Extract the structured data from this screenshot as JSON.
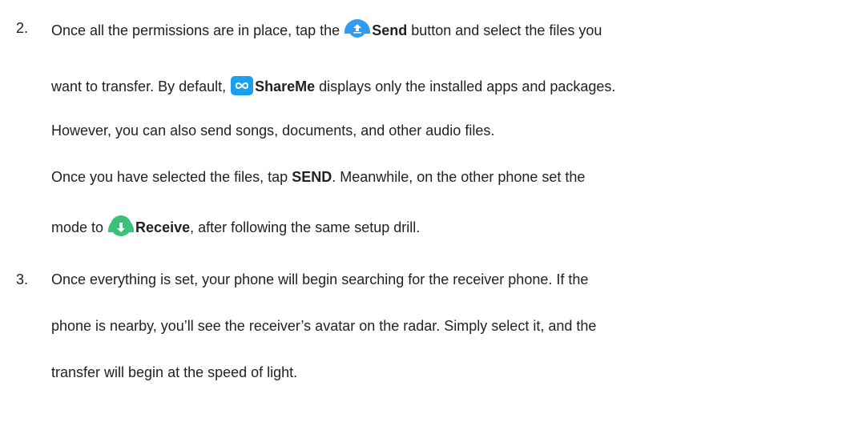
{
  "steps": [
    {
      "number": "2.",
      "lines": {
        "l1_before": "Once all the permissions are in place, tap the ",
        "l1_bold": "Send",
        "l1_after": " button and select the files you",
        "l2_before": "want to transfer. By default, ",
        "l2_bold": "ShareMe",
        "l2_after": " displays only the installed apps and packages.",
        "l3": "However, you can also send songs, documents, and other audio files.",
        "l4_before": "Once you have selected the files, tap ",
        "l4_bold": "SEND",
        "l4_after": ". Meanwhile, on the other phone set the",
        "l5_before": "mode to ",
        "l5_bold": "Receive",
        "l5_after": ", after following the same setup drill."
      }
    },
    {
      "number": "3.",
      "lines": {
        "l1": "Once everything is set, your phone will begin searching for the receiver phone. If the",
        "l2": "phone is nearby, you’ll see the receiver’s avatar on the radar. Simply select it, and the",
        "l3": "transfer will begin at the speed of light."
      }
    }
  ],
  "icons": {
    "send": {
      "name": "send-upload-icon",
      "color": "#2f9cf3"
    },
    "shareme": {
      "name": "shareme-infinity-icon",
      "color": "#1aa0f0"
    },
    "receive": {
      "name": "receive-download-icon",
      "color": "#3cc07a"
    }
  }
}
